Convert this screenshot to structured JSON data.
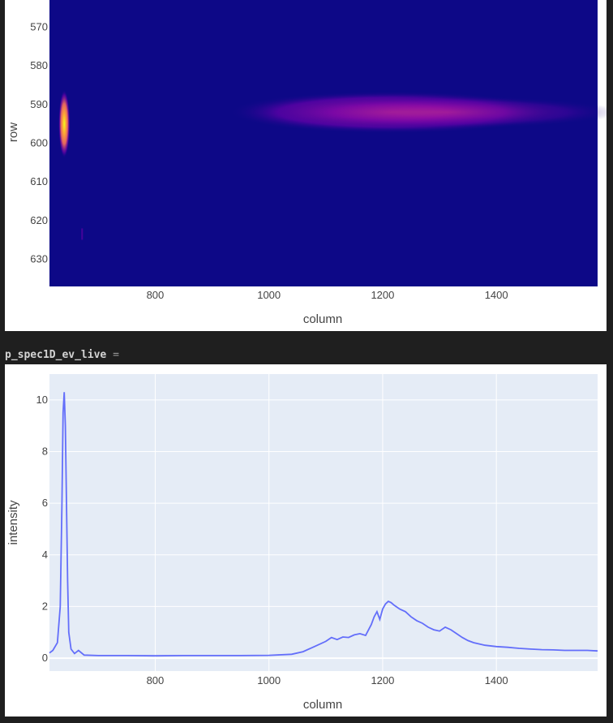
{
  "notebook": {
    "variable_name": "p_spec1D_ev_live",
    "operator": "="
  },
  "colors": {
    "background": "#1f1f1f",
    "plot_bg": "#e5ecf6",
    "line": "#636efa",
    "heatmap_low": "#0d0887",
    "heatmap_mid": "#9c179e",
    "heatmap_high": "#f0f921"
  },
  "chart_data": [
    {
      "type": "heatmap",
      "title": "",
      "xlabel": "column",
      "ylabel": "row",
      "xlim": [
        614,
        1578
      ],
      "ylim": [
        637,
        563
      ],
      "x_ticks": [
        "800",
        "1000",
        "1200",
        "1400"
      ],
      "y_ticks": [
        "570",
        "580",
        "590",
        "600",
        "610",
        "620",
        "630"
      ],
      "colorscale": "plasma",
      "features": [
        {
          "label": "narrow bright spot",
          "x_center": 640,
          "y_center": 595,
          "peak_value": 10.3
        },
        {
          "label": "broad diffuse band",
          "x_center": 1215,
          "y_center": 592,
          "peak_value": 2.2
        }
      ]
    },
    {
      "type": "line",
      "title": "",
      "xlabel": "column",
      "ylabel": "intensity",
      "xlim": [
        614,
        1578
      ],
      "ylim": [
        -0.5,
        11
      ],
      "x_ticks": [
        "800",
        "1000",
        "1200",
        "1400"
      ],
      "y_ticks": [
        "0",
        "2",
        "4",
        "6",
        "8",
        "10"
      ],
      "series": [
        {
          "x": [
            614,
            620,
            628,
            633,
            636,
            638,
            640,
            642,
            644,
            646,
            648,
            652,
            658,
            665,
            675,
            700,
            750,
            800,
            850,
            900,
            950,
            1000,
            1040,
            1060,
            1080,
            1100,
            1110,
            1120,
            1130,
            1140,
            1150,
            1160,
            1170,
            1180,
            1185,
            1190,
            1195,
            1200,
            1205,
            1210,
            1215,
            1220,
            1230,
            1240,
            1250,
            1260,
            1270,
            1280,
            1290,
            1300,
            1310,
            1320,
            1330,
            1340,
            1350,
            1360,
            1380,
            1400,
            1420,
            1440,
            1460,
            1480,
            1500,
            1520,
            1540,
            1560,
            1578
          ],
          "y": [
            0.2,
            0.3,
            0.6,
            2.0,
            6.0,
            9.5,
            10.3,
            9.0,
            6.0,
            3.0,
            1.0,
            0.35,
            0.18,
            0.3,
            0.12,
            0.1,
            0.1,
            0.09,
            0.1,
            0.1,
            0.1,
            0.11,
            0.15,
            0.25,
            0.45,
            0.65,
            0.8,
            0.72,
            0.82,
            0.8,
            0.9,
            0.95,
            0.88,
            1.3,
            1.6,
            1.8,
            1.5,
            1.9,
            2.1,
            2.2,
            2.15,
            2.05,
            1.9,
            1.8,
            1.6,
            1.45,
            1.35,
            1.2,
            1.1,
            1.05,
            1.2,
            1.1,
            0.95,
            0.8,
            0.68,
            0.6,
            0.5,
            0.45,
            0.42,
            0.38,
            0.35,
            0.33,
            0.32,
            0.3,
            0.3,
            0.3,
            0.28
          ]
        }
      ]
    }
  ]
}
